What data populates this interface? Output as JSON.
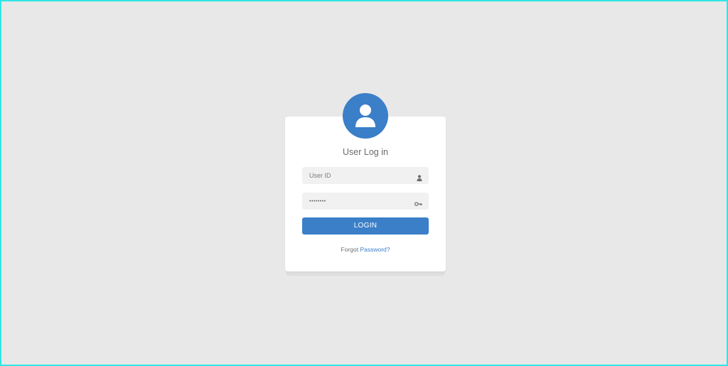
{
  "login_card": {
    "title": "User Log in",
    "user_id_placeholder": "User ID",
    "password_value": "••••••••",
    "login_button": "LOGIN",
    "forgot_prefix": "Forgot",
    "forgot_link": "Password?"
  },
  "icons": {
    "avatar": "user-avatar-icon",
    "user_field": "person-icon",
    "password_field": "key-icon"
  },
  "colors": {
    "accent": "#3a7fc8",
    "background": "#e8e8e8",
    "card": "#ffffff",
    "input_background": "#f1f1f1",
    "frame_border": "#2ee6e6"
  }
}
